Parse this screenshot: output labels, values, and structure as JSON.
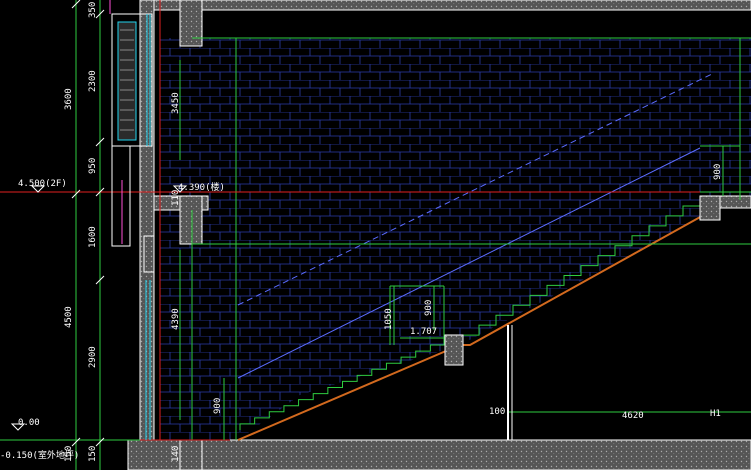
{
  "drawing": {
    "background": "#000000",
    "colors": {
      "wall_hatch": "#1e2a8c",
      "grid_green": "#2ecc40",
      "axis_red": "#e02020",
      "outline_white": "#ffffff",
      "concrete_fill": "#6e6e6e",
      "window_cyan": "#22d3ee",
      "finish_orange": "#d2691e",
      "stair_blue": "#5b6cff",
      "magenta": "#ff4fd8"
    },
    "dimensions_vertical": {
      "d350": "350",
      "d2300": "2300",
      "d3600": "3600",
      "d950": "950",
      "d1600": "1600",
      "d4500": "4500",
      "d2900": "2900",
      "d3450": "3450",
      "d4390": "4390",
      "d110": "110",
      "d900_left": "900",
      "d900_right": "900",
      "d1050": "1050",
      "d900_mid": "900",
      "d150_a": "150",
      "d150_b": "150",
      "d140": "140"
    },
    "dimensions_horizontal": {
      "d1707": "1.707",
      "d100": "100",
      "d4620": "4620",
      "h1": "H1"
    },
    "levels": {
      "level_2f": "4.500(2F)",
      "level_stair": "4.390(楼)",
      "level_ground": "0.00",
      "level_bottom": "-0.150(室外地坪)"
    }
  }
}
